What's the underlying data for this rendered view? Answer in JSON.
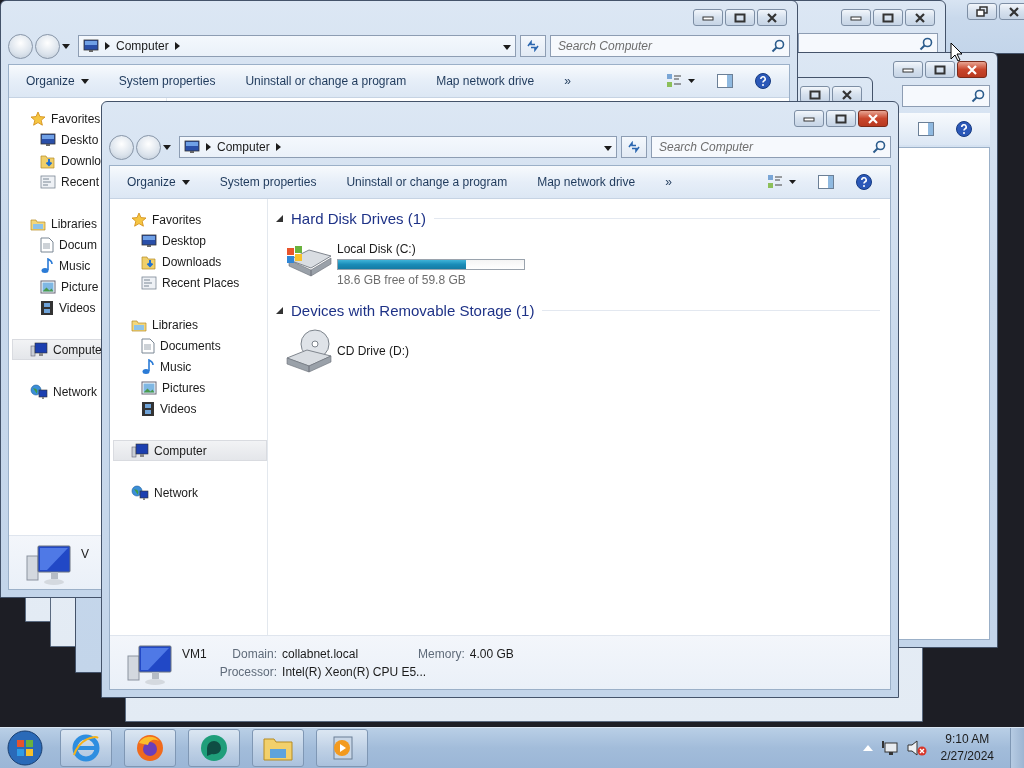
{
  "back_windows": [
    {
      "restore": true,
      "close_highlighted": false,
      "search": false,
      "toolbar": false
    },
    {
      "restore": false,
      "close_highlighted": false,
      "search": true,
      "toolbar": false
    },
    {
      "restore": false,
      "close_highlighted": true,
      "search": true,
      "toolbar": true
    },
    {
      "restore": false,
      "close_highlighted": false,
      "search": false,
      "toolbar": false
    }
  ],
  "behind_window": {
    "address": "Computer",
    "search_placeholder": "Search Computer",
    "close_highlighted": false,
    "toolbar": [
      "Organize",
      "System properties",
      "Uninstall or change a program",
      "Map network drive"
    ],
    "more": "»",
    "nav": [
      {
        "label": "Favorites",
        "selected": false,
        "children": [
          {
            "label": "Deskto",
            "selected": false
          },
          {
            "label": "Downlo",
            "selected": false
          },
          {
            "label": "Recent",
            "selected": false
          }
        ]
      },
      {
        "label": "Libraries",
        "selected": false,
        "children": [
          {
            "label": "Docum",
            "selected": false
          },
          {
            "label": "Music",
            "selected": false
          },
          {
            "label": "Picture",
            "selected": false
          },
          {
            "label": "Videos",
            "selected": false
          }
        ]
      },
      {
        "label": "Compute",
        "selected": true
      },
      {
        "label": "Network",
        "selected": false
      }
    ],
    "details": {
      "name": "V"
    }
  },
  "window": {
    "address": "Computer",
    "search_placeholder": "Search Computer",
    "close_highlighted": true,
    "toolbar": [
      "Organize",
      "System properties",
      "Uninstall or change a program",
      "Map network drive"
    ],
    "more": "»",
    "nav": [
      {
        "label": "Favorites",
        "selected": false,
        "children": [
          {
            "label": "Desktop",
            "selected": false
          },
          {
            "label": "Downloads",
            "selected": false
          },
          {
            "label": "Recent Places",
            "selected": false
          }
        ]
      },
      {
        "label": "Libraries",
        "selected": false,
        "children": [
          {
            "label": "Documents",
            "selected": false
          },
          {
            "label": "Music",
            "selected": false
          },
          {
            "label": "Pictures",
            "selected": false
          },
          {
            "label": "Videos",
            "selected": false
          }
        ]
      },
      {
        "label": "Computer",
        "selected": true
      },
      {
        "label": "Network",
        "selected": false
      }
    ],
    "sections": [
      {
        "title": "Hard Disk Drives (1)",
        "expanded": true,
        "items": [
          {
            "kind": "disk",
            "name": "Local Disk (C:)",
            "level": 0.69,
            "free": "18.6 GB free of 59.8 GB"
          }
        ]
      },
      {
        "title": "Devices with Removable Storage (1)",
        "expanded": true,
        "items": [
          {
            "kind": "cd",
            "name": "CD Drive (D:)"
          }
        ]
      }
    ],
    "details": {
      "name": "VM1",
      "fields": [
        {
          "label": "Domain:",
          "value": "collabnet.local"
        },
        {
          "label": "Memory:",
          "value": "4.00 GB"
        },
        {
          "label": "Processor:",
          "value": "Intel(R) Xeon(R) CPU E5..."
        }
      ]
    }
  },
  "taskbar": {
    "time": "9:10 AM",
    "date": "2/27/2024",
    "volume_muted": true
  }
}
